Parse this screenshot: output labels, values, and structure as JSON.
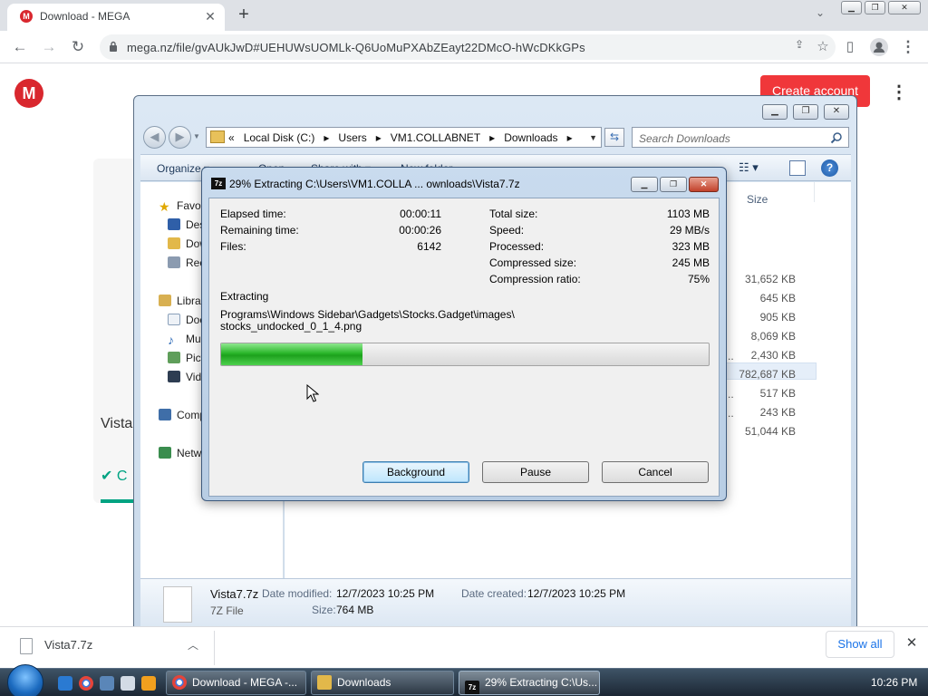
{
  "browser": {
    "tab_title": "Download - MEGA",
    "tab_favicon": "M",
    "url": "mega.nz/file/gvAUkJwD#UEHUWsUOMLk-Q6UoMuPXAbZEayt22DMcO-hWcDKkGPs"
  },
  "mega": {
    "logo": "M",
    "create_account": "Create account",
    "filename_partial": "Vista",
    "status_partial": "C"
  },
  "explorer": {
    "breadcrumb": [
      "«",
      "Local Disk (C:)",
      "▸",
      "Users",
      "▸",
      "VM1.COLLABNET",
      "▸",
      "Downloads",
      "▸"
    ],
    "search_placeholder": "Search Downloads",
    "toolbar": {
      "organize": "Organize ▾",
      "open": "Open",
      "share_with": "Share with ▾",
      "new_folder": "New folder"
    },
    "nav": {
      "favorites": "Favorites",
      "desktop": "Desktop",
      "downloads": "Downloads",
      "recent": "Recent Places",
      "libraries": "Libraries",
      "documents": "Documents",
      "music": "Music",
      "pictures": "Pictures",
      "videos": "Videos",
      "computer": "Computer",
      "network": "Network"
    },
    "column_size": "Size",
    "type_fragments": [
      "p...",
      "p...",
      "p..."
    ],
    "sizes": [
      "31,652 KB",
      "645 KB",
      "905 KB",
      "8,069 KB",
      "2,430 KB",
      "782,687 KB",
      "517 KB",
      "243 KB",
      "51,044 KB"
    ],
    "details": {
      "name": "Vista7.7z",
      "type": "7Z File",
      "modified_label": "Date modified:",
      "modified_value": "12/7/2023 10:25 PM",
      "created_label": "Date created:",
      "created_value": "12/7/2023 10:25 PM",
      "size_label": "Size:",
      "size_value": "764 MB"
    }
  },
  "zip": {
    "icon": "7z",
    "title": "29% Extracting C:\\Users\\VM1.COLLA ... ownloads\\Vista7.7z",
    "stats_left": [
      {
        "label": "Elapsed time:",
        "value": "00:00:11"
      },
      {
        "label": "Remaining time:",
        "value": "00:00:26"
      },
      {
        "label": "Files:",
        "value": "6142"
      }
    ],
    "stats_right": [
      {
        "label": "Total size:",
        "value": "1103 MB"
      },
      {
        "label": "Speed:",
        "value": "29 MB/s"
      },
      {
        "label": "Processed:",
        "value": "323 MB"
      },
      {
        "label": "Compressed size:",
        "value": "245 MB"
      },
      {
        "label": "Compression ratio:",
        "value": "75%"
      }
    ],
    "action": "Extracting",
    "path_line1": "Programs\\Windows Sidebar\\Gadgets\\Stocks.Gadget\\images\\",
    "path_line2": "stocks_undocked_0_1_4.png",
    "progress_fraction": 0.29,
    "buttons": {
      "background": "Background",
      "pause": "Pause",
      "cancel": "Cancel"
    }
  },
  "downloads_bar": {
    "file": "Vista7.7z",
    "show_all": "Show all"
  },
  "taskbar": {
    "tasks": [
      "Download - MEGA -...",
      "Downloads",
      "29% Extracting C:\\Us..."
    ],
    "task_zip_icon": "7z",
    "clock": "10:26 PM"
  },
  "colors": {
    "mega_red": "#d9272e",
    "progress_green": "#29b629",
    "chrome_link": "#1a73e8"
  }
}
